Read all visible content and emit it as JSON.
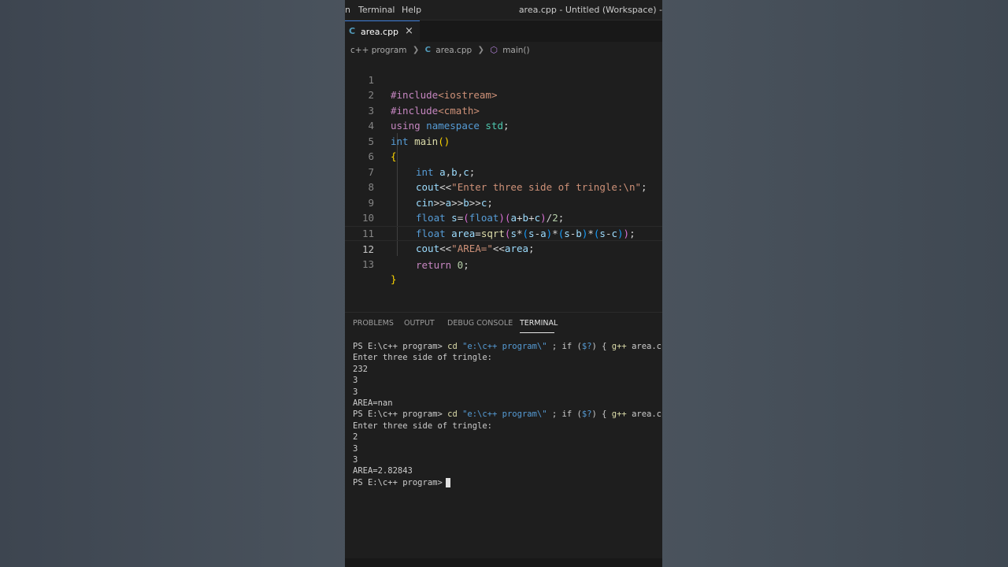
{
  "menu": {
    "items": [
      "n",
      "Terminal",
      "Help"
    ]
  },
  "window": {
    "title": "area.cpp - Untitled (Workspace) -"
  },
  "tab": {
    "label": "area.cpp",
    "icon_glyph": "C",
    "close_glyph": "×"
  },
  "breadcrumb": {
    "folder": "c++ program",
    "file": "area.cpp",
    "symbol": "main()"
  },
  "editor": {
    "current_line": 12,
    "lines": [
      {
        "n": "1"
      },
      {
        "n": "2"
      },
      {
        "n": "3"
      },
      {
        "n": "4"
      },
      {
        "n": "5"
      },
      {
        "n": "6"
      },
      {
        "n": "7"
      },
      {
        "n": "8"
      },
      {
        "n": "9"
      },
      {
        "n": "10"
      },
      {
        "n": "11"
      },
      {
        "n": "12"
      },
      {
        "n": "13"
      }
    ],
    "tokens": {
      "l1": [
        "#include",
        "<iostream>"
      ],
      "l2": [
        "#include",
        "<cmath>"
      ],
      "l3": [
        "using",
        " namespace",
        " std",
        ";"
      ],
      "l4": [
        "int",
        " main",
        "()"
      ],
      "l5": [
        "{"
      ],
      "l6": [
        "int",
        " a",
        ",",
        "b",
        ",",
        "c",
        ";"
      ],
      "l7": [
        "cout",
        "<<",
        "\"Enter three side of tringle:\\n\"",
        ";"
      ],
      "l8": [
        "cin",
        ">>",
        "a",
        ">>",
        "b",
        ">>",
        "c",
        ";"
      ],
      "l9": [
        "float",
        " s",
        "=",
        "(",
        "float",
        ")",
        "(",
        "a",
        "+",
        "b",
        "+",
        "c",
        ")",
        "/",
        "2",
        ";"
      ],
      "l10": [
        "float",
        " area",
        "=",
        "sqrt",
        "(",
        "s",
        "*",
        "(",
        "s",
        "-",
        "a",
        ")",
        "*",
        "(",
        "s",
        "-",
        "b",
        ")",
        "*",
        "(",
        "s",
        "-",
        "c",
        ")",
        ")",
        ";"
      ],
      "l11": [
        "cout",
        "<<",
        "\"AREA=\"",
        "<<",
        "area",
        ";"
      ],
      "l12": [
        "return",
        " 0",
        ";"
      ],
      "l13": [
        "}"
      ]
    }
  },
  "panel": {
    "tabs": [
      "PROBLEMS",
      "OUTPUT",
      "DEBUG CONSOLE",
      "TERMINAL"
    ],
    "active_tab": "TERMINAL"
  },
  "terminal": {
    "prompt": "PS E:\\c++ program>",
    "cmd_cd": " cd",
    "cmd_path": " \"e:\\c++ program\\\"",
    "cmd_if": " ; if (",
    "cmd_var": "$?",
    "cmd_rest": ") { ",
    "cmd_gpp": "g++",
    "cmd_tail": " area.cpp -o",
    "run1": [
      "Enter three side of tringle:",
      "232",
      "3",
      "3",
      "AREA=nan"
    ],
    "run2": [
      "Enter three side of tringle:",
      "2",
      "3",
      "3",
      "AREA=2.82843"
    ]
  }
}
